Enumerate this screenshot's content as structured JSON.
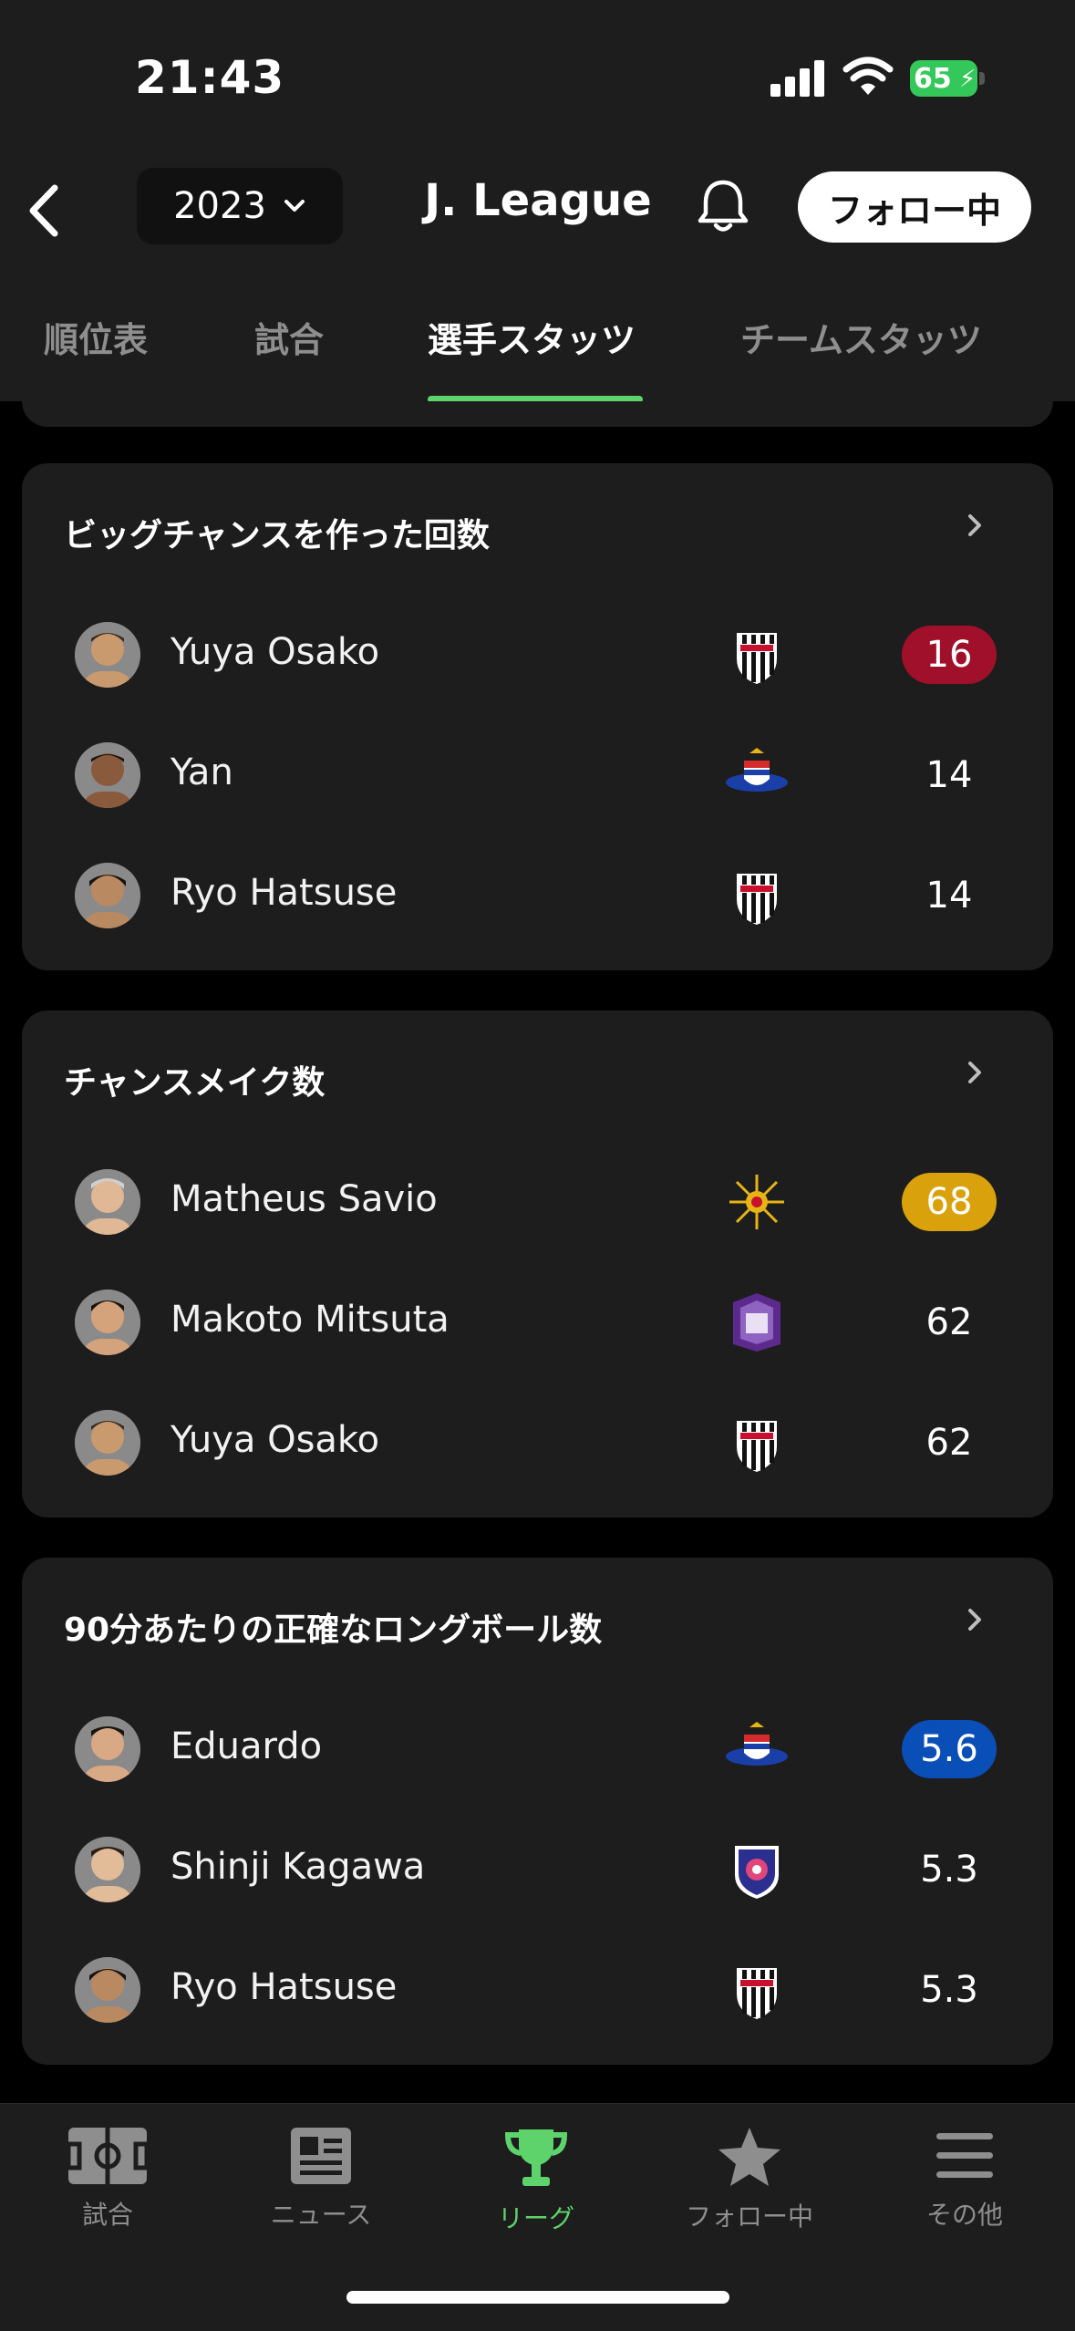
{
  "status": {
    "time": "21:43",
    "battery": "65"
  },
  "header": {
    "year": "2023",
    "title": "J. League",
    "follow_label": "フォロー中"
  },
  "tabs": [
    {
      "label": "順位表"
    },
    {
      "label": "試合"
    },
    {
      "label": "選手スタッツ"
    },
    {
      "label": "チームスタッツ"
    }
  ],
  "cards": [
    {
      "title": "ビッグチャンスを作った回数",
      "rows": [
        {
          "name": "Yuya Osako",
          "club": "vissel",
          "value": "16",
          "badge": "#a0102b"
        },
        {
          "name": "Yan",
          "club": "marinos",
          "value": "14"
        },
        {
          "name": "Ryo Hatsuse",
          "club": "vissel",
          "value": "14"
        }
      ]
    },
    {
      "title": "チャンスメイク数",
      "rows": [
        {
          "name": "Matheus Savio",
          "club": "kashiwa",
          "value": "68",
          "badge": "#d9a20c"
        },
        {
          "name": "Makoto Mitsuta",
          "club": "sanfrecce",
          "value": "62"
        },
        {
          "name": "Yuya Osako",
          "club": "vissel",
          "value": "62"
        }
      ]
    },
    {
      "title": "90分あたりの正確なロングボール数",
      "rows": [
        {
          "name": "Eduardo",
          "club": "marinos",
          "value": "5.6",
          "badge": "#0a4fb8"
        },
        {
          "name": "Shinji Kagawa",
          "club": "cerezo",
          "value": "5.3"
        },
        {
          "name": "Ryo Hatsuse",
          "club": "vissel",
          "value": "5.3"
        }
      ]
    }
  ],
  "nav": [
    {
      "label": "試合",
      "icon": "pitch-icon"
    },
    {
      "label": "ニュース",
      "icon": "news-icon"
    },
    {
      "label": "リーグ",
      "icon": "trophy-icon",
      "active": true
    },
    {
      "label": "フォロー中",
      "icon": "star-icon"
    },
    {
      "label": "その他",
      "icon": "menu-icon"
    }
  ],
  "colors": {
    "accent": "#5fd36b",
    "card": "#1d1d1d",
    "background": "#000000"
  }
}
